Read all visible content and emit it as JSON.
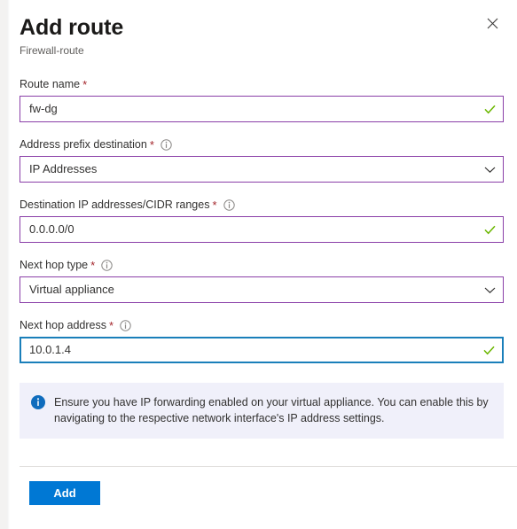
{
  "header": {
    "title": "Add route",
    "subtitle": "Firewall-route",
    "close_icon": "close-icon"
  },
  "form": {
    "fields": [
      {
        "label": "Route name",
        "required_marker": "*",
        "has_info": false,
        "type": "text",
        "value": "fw-dg",
        "placeholder": "",
        "state": "valid",
        "adornment": "check-icon"
      },
      {
        "label": "Address prefix destination",
        "required_marker": "*",
        "has_info": true,
        "type": "select",
        "value": "IP Addresses",
        "placeholder": "",
        "state": "valid",
        "adornment": "chevron-down-icon"
      },
      {
        "label": "Destination IP addresses/CIDR ranges",
        "required_marker": "*",
        "has_info": true,
        "type": "text",
        "value": "0.0.0.0/0",
        "placeholder": "",
        "state": "valid",
        "adornment": "check-icon"
      },
      {
        "label": "Next hop type",
        "required_marker": "*",
        "has_info": true,
        "type": "select",
        "value": "Virtual appliance",
        "placeholder": "",
        "state": "valid",
        "adornment": "chevron-down-icon"
      },
      {
        "label": "Next hop address",
        "required_marker": "*",
        "has_info": true,
        "type": "text",
        "value": "10.0.1.4",
        "placeholder": "",
        "state": "focused",
        "adornment": "check-icon"
      }
    ]
  },
  "banner": {
    "icon": "info-circle-icon",
    "text": "Ensure you have IP forwarding enabled on your virtual appliance. You can enable this by navigating to the respective network interface's IP address settings."
  },
  "footer": {
    "add_label": "Add"
  },
  "colors": {
    "accent": "#0078d4",
    "validation_border": "#8a3fa8",
    "focus_border": "#1a7fba",
    "success_check": "#6bb700",
    "required_star": "#a4262c",
    "banner_bg": "#f0f0fa",
    "info_blue": "#0f6cbd"
  }
}
